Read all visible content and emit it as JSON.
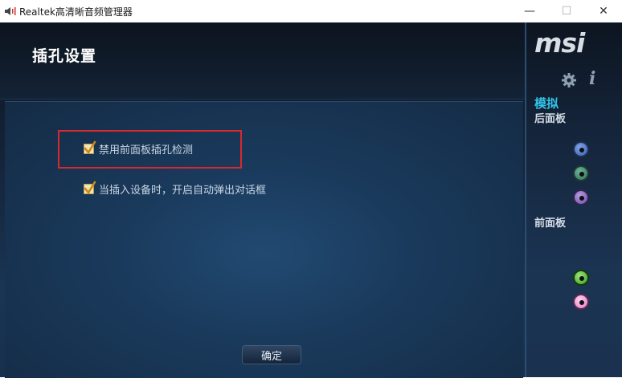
{
  "window": {
    "title": "Realtek高清晰音频管理器",
    "minimize_glyph": "—",
    "maximize_glyph": "☐",
    "close_glyph": "✕"
  },
  "page": {
    "title": "插孔设置"
  },
  "options": [
    {
      "label": "禁用前面板插孔检测",
      "checked": true,
      "highlighted": true
    },
    {
      "label": "当插入设备时，开启自动弹出对话框",
      "checked": true,
      "highlighted": false
    }
  ],
  "ok_button": {
    "label": "确定"
  },
  "sidebar": {
    "logo": "msi",
    "info_glyph": "i",
    "mode_label": "模拟",
    "rear_panel_label": "后面板",
    "front_panel_label": "前面板",
    "rear_jacks": [
      {
        "icon": "jack-blue-icon",
        "color": "#5b82d6"
      },
      {
        "icon": "jack-green-icon",
        "color": "#4a9078"
      },
      {
        "icon": "jack-purple-icon",
        "color": "#9478c8"
      }
    ],
    "front_jacks": [
      {
        "icon": "jack-green-icon",
        "color": "#5cc23c"
      },
      {
        "icon": "jack-pink-icon",
        "color": "#f0a0d8"
      }
    ]
  },
  "colors": {
    "highlight_border": "#d9282e",
    "accent_cyan": "#33c3e8",
    "panel_dark": "#0e1621"
  }
}
